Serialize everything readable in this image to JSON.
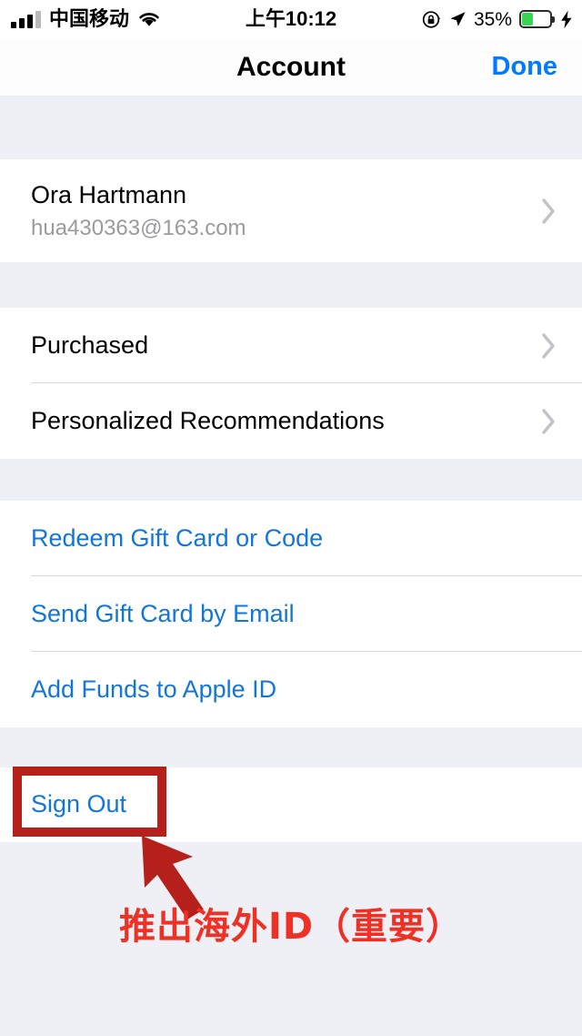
{
  "status_bar": {
    "carrier": "中国移动",
    "time": "上午10:12",
    "battery_percent": "35%",
    "signal_bars_filled": 3,
    "signal_bars_total": 4,
    "icons": [
      "signal-bars-icon",
      "wifi-icon",
      "rotation-lock-icon",
      "location-arrow-icon",
      "battery-icon",
      "charging-bolt-icon"
    ],
    "battery_fill_color": "#3ad453",
    "charging": true
  },
  "navbar": {
    "title": "Account",
    "done_label": "Done",
    "accent_color": "#007aff"
  },
  "sections": [
    {
      "id": "account-section",
      "rows": [
        {
          "name": "Ora Hartmann",
          "email": "hua430363@163.com",
          "chevron": true
        }
      ]
    },
    {
      "id": "library-section",
      "rows": [
        {
          "label": "Purchased",
          "chevron": true
        },
        {
          "label": "Personalized Recommendations",
          "chevron": true
        }
      ]
    },
    {
      "id": "giftcard-section",
      "rows": [
        {
          "label": "Redeem Gift Card or Code",
          "chevron": false
        },
        {
          "label": "Send Gift Card by Email",
          "chevron": false
        },
        {
          "label": "Add Funds to Apple ID",
          "chevron": false
        }
      ]
    },
    {
      "id": "signout-section",
      "rows": [
        {
          "label": "Sign Out",
          "chevron": false
        }
      ]
    }
  ],
  "annotation": {
    "caption": "推出海外ID（重要）",
    "box_color": "#b5201a",
    "caption_color": "#ee3124",
    "target": "Sign Out"
  },
  "colors": {
    "link_blue": "#1276d9",
    "group_background": "#eff0f5",
    "row_background": "#ffffff",
    "separator": "#d8d8dc",
    "subtitle_gray": "#9b9b9f"
  }
}
